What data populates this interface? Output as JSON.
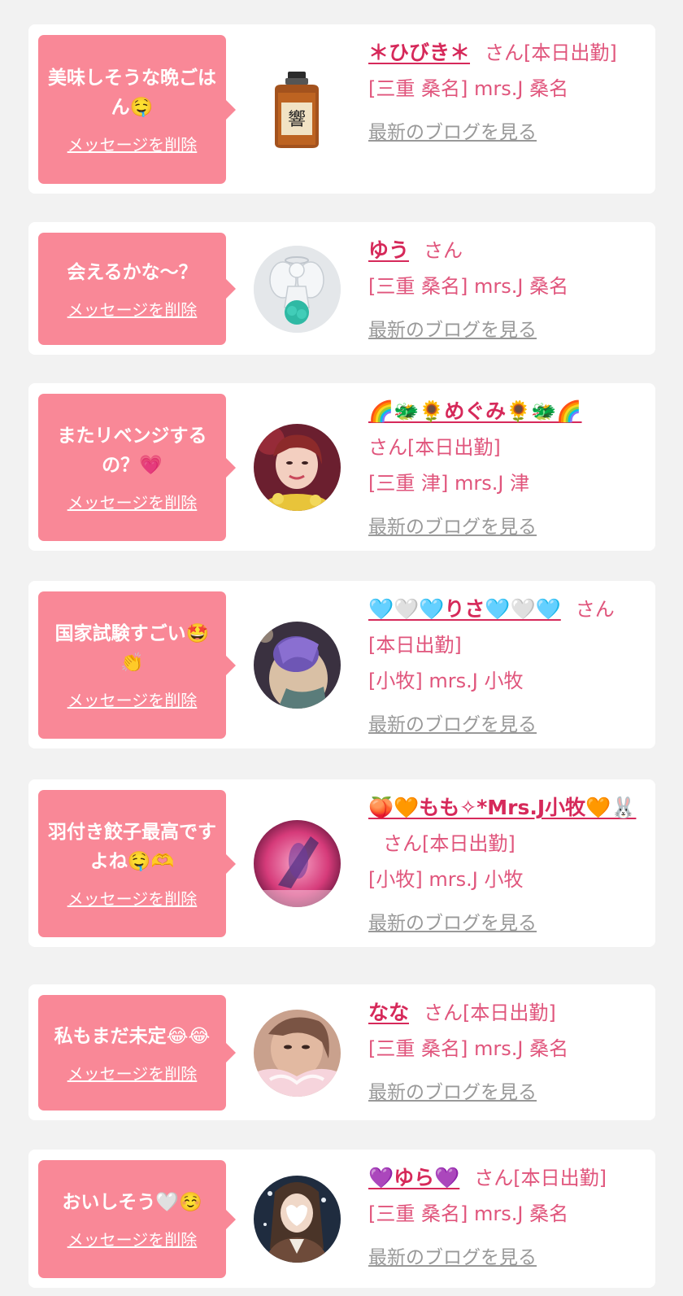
{
  "colors": {
    "page_bg": "#f2f2f2",
    "bubble_bg": "#f98897",
    "name_color": "#d6295a",
    "text_color": "#e0557c",
    "blog_link_color": "#999999"
  },
  "messages": [
    {
      "message": "美味しそうな晩ごはん🤤",
      "delete_label": "メッセージを削除",
      "name": "＊ひびき＊",
      "san_suffix": "さん[本日出勤]",
      "shop": "[三重 桑名] mrs.J 桑名",
      "blog_label": "最新のブログを見る",
      "avatar_icon": "whisky-bottle-image"
    },
    {
      "message": "会えるかな～？",
      "delete_label": "メッセージを削除",
      "name": "ゆう",
      "san_suffix": "さん",
      "shop": "[三重 桑名] mrs.J 桑名",
      "blog_label": "最新のブログを見る",
      "avatar_icon": "angel-figurine-photo"
    },
    {
      "message": "またリベンジするの？💗",
      "delete_label": "メッセージを削除",
      "name": "🌈🐲🌻めぐみ🌻🐲🌈",
      "san_suffix": "さん[本日出勤]",
      "shop": "[三重 津] mrs.J 津",
      "blog_label": "最新のブログを見る",
      "avatar_icon": "woman-portrait-photo"
    },
    {
      "message": "国家試験すごい🤩👏",
      "delete_label": "メッセージを削除",
      "name": "🩵🤍🩵りさ🩵🤍🩵",
      "san_suffix": "さん[本日出勤]",
      "shop": "[小牧] mrs.J 小牧",
      "blog_label": "最新のブログを見る",
      "avatar_icon": "woman-blurred-photo"
    },
    {
      "message": "羽付き餃子最高ですよね🤤🫶",
      "delete_label": "メッセージを削除",
      "name": "🍑🧡もも✧*Mrs.J小牧🧡🐰",
      "san_suffix": "さん[本日出勤]",
      "shop": "[小牧] mrs.J 小牧",
      "blog_label": "最新のブログを見る",
      "avatar_icon": "pink-blurred-photo"
    },
    {
      "message": "私もまだ未定😂😂",
      "delete_label": "メッセージを削除",
      "name": "なな",
      "san_suffix": "さん[本日出勤]",
      "shop": "[三重 桑名] mrs.J 桑名",
      "blog_label": "最新のブログを見る",
      "avatar_icon": "woman-face-photo"
    },
    {
      "message": "おいしそう🤍☺️",
      "delete_label": "メッセージを削除",
      "name": "💜ゆら💜",
      "san_suffix": "さん[本日出勤]",
      "shop": "[三重 桑名] mrs.J 桑名",
      "blog_label": "最新のブログを見る",
      "avatar_icon": "woman-kimono-photo"
    }
  ]
}
